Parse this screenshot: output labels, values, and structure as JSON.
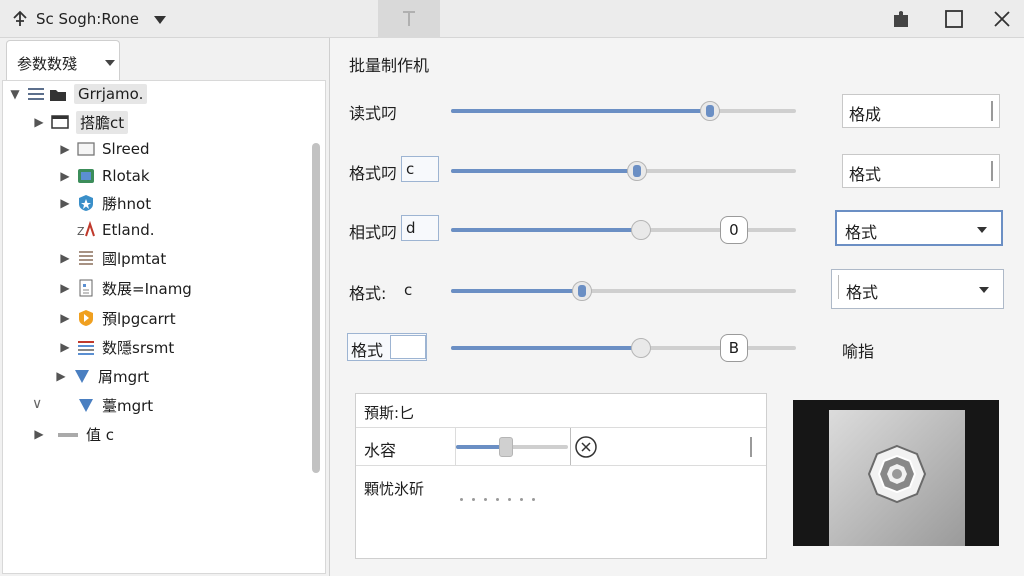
{
  "titlebar": {
    "title": "Sc Sogh:Rone",
    "icons": [
      "pin-icon",
      "menu-caret-icon",
      "center-tab-icon",
      "extension-icon",
      "maximize-icon",
      "close-icon"
    ]
  },
  "left_panel": {
    "tab_label": "参数数殘",
    "tree": [
      {
        "arrow": "▼",
        "icon": "folder-icon",
        "label": "Grrjamo."
      },
      {
        "arrow": "▶",
        "icon": "window-icon",
        "label": "搭膽ct"
      },
      {
        "arrow": "▶",
        "icon": "window-icon",
        "label": "Slreed"
      },
      {
        "arrow": "▶",
        "icon": "map-icon",
        "label": "Rlotak"
      },
      {
        "arrow": "▶",
        "icon": "shield-star-icon",
        "label": "勝hnot"
      },
      {
        "arrow": "",
        "icon": "za-icon",
        "label": "Etland."
      },
      {
        "arrow": "▶",
        "icon": "list-icon",
        "label": "國lpmtat"
      },
      {
        "arrow": "▶",
        "icon": "document-icon",
        "label": "数展=Inamg"
      },
      {
        "arrow": "▶",
        "icon": "orange-shield-icon",
        "label": "預lpgcarrt"
      },
      {
        "arrow": "▶",
        "icon": "stripes-icon",
        "label": "数隱srsmt"
      },
      {
        "arrow": "▶",
        "icon": "triangle-icon",
        "label": "屑mgrt"
      },
      {
        "arrow": "",
        "icon": "triangle-icon",
        "label": "薹mgrt"
      },
      {
        "arrow": "▶",
        "icon": "bar-icon",
        "label": "值 c"
      }
    ],
    "collapsed_marker": "∨"
  },
  "right_panel": {
    "section_title": "批量制作机",
    "params": [
      {
        "label": "读式叼",
        "box": "",
        "value_fraction": 0.75,
        "field": "格成",
        "control": "field"
      },
      {
        "label": "格式叼",
        "box": "c",
        "value_fraction": 0.54,
        "field": "格式",
        "control": "field"
      },
      {
        "label": "相式叼",
        "box": "d",
        "value_fraction": 0.55,
        "bubble": "0",
        "field": "格式",
        "control": "combo-focus"
      },
      {
        "label": "格式:",
        "box": "c",
        "value_fraction": 0.38,
        "field": "格式",
        "control": "combo"
      },
      {
        "label": "格式",
        "box": "",
        "value_fraction": 0.55,
        "bubble": "B",
        "field": "喻指",
        "control": "text"
      }
    ],
    "group": {
      "header": "預斯:匕",
      "row_label": "水容",
      "footer": "顆忧氷斫",
      "mini_slider_fraction": 0.45
    },
    "accent": "#6b8fc4"
  }
}
